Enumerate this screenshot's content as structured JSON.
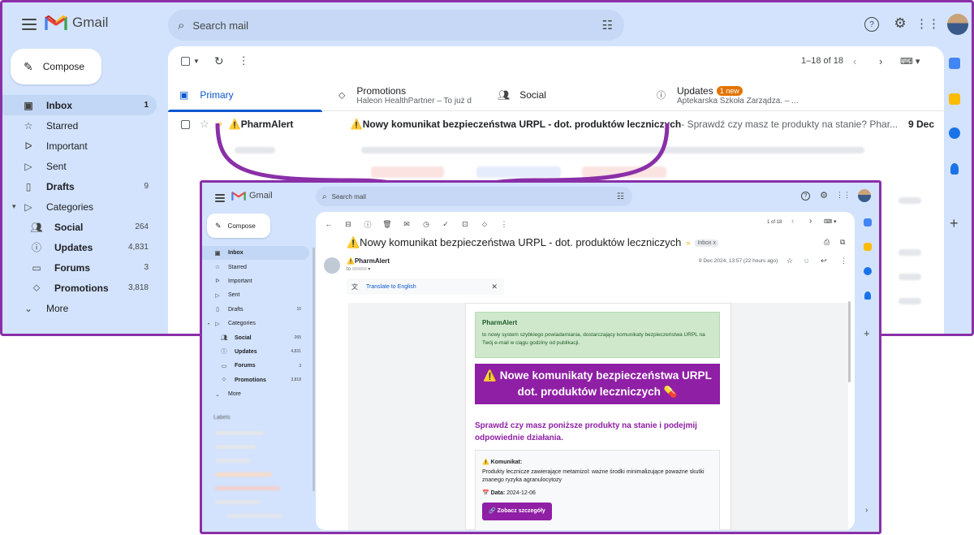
{
  "app": {
    "logo_text": "Gmail",
    "search_placeholder": "Search mail",
    "compose_label": "Compose"
  },
  "colors": {
    "accent_purple": "#8f1fa5",
    "frame_purple": "#8a2fa8",
    "gmail_bg": "#d3e3fd",
    "primary_blue": "#0b57d0",
    "updates_badge": "#e37400",
    "green_box": "#cfe8cc"
  },
  "back": {
    "nav": [
      {
        "label": "Inbox",
        "count": "1",
        "icon": "inbox-icon",
        "bold": true,
        "active": true
      },
      {
        "label": "Starred",
        "count": "",
        "icon": "star-icon"
      },
      {
        "label": "Important",
        "count": "",
        "icon": "important-icon"
      },
      {
        "label": "Sent",
        "count": "",
        "icon": "send-icon"
      },
      {
        "label": "Drafts",
        "count": "9",
        "icon": "draft-icon",
        "bold": true
      },
      {
        "label": "Categories",
        "count": "",
        "icon": "label-icon"
      },
      {
        "label": "Social",
        "count": "264",
        "icon": "people-icon",
        "bold": true
      },
      {
        "label": "Updates",
        "count": "4,831",
        "icon": "info-icon",
        "bold": true
      },
      {
        "label": "Forums",
        "count": "3",
        "icon": "forum-icon",
        "bold": true
      },
      {
        "label": "Promotions",
        "count": "3,818",
        "icon": "tag-icon",
        "bold": true
      },
      {
        "label": "More",
        "count": "",
        "icon": "chevron-down-icon"
      }
    ],
    "pagination": "1–18 of 18",
    "tabs": [
      {
        "label": "Primary",
        "sub": "",
        "badge": ""
      },
      {
        "label": "Promotions",
        "sub": "Haleon HealthPartner – To już d...",
        "badge": ""
      },
      {
        "label": "Social",
        "sub": "",
        "badge": ""
      },
      {
        "label": "Updates",
        "sub": "Aptekarska Szkoła Zarządza. – ...",
        "badge": "1 new"
      }
    ],
    "first_row": {
      "sender": "⚠️PharmAlert",
      "subject": "⚠️Nowy komunikat bezpieczeństwa URPL - dot. produktów leczniczych",
      "snippet": " - Sprawdź czy masz te produkty na stanie? Phar...",
      "date": "9 Dec"
    }
  },
  "front": {
    "nav": [
      {
        "label": "Inbox",
        "count": "",
        "icon": "inbox-icon",
        "bold": true,
        "active": true
      },
      {
        "label": "Starred",
        "count": "",
        "icon": "star-icon"
      },
      {
        "label": "Important",
        "count": "",
        "icon": "important-icon"
      },
      {
        "label": "Sent",
        "count": "",
        "icon": "send-icon"
      },
      {
        "label": "Drafts",
        "count": "10",
        "icon": "draft-icon"
      },
      {
        "label": "Categories",
        "count": "",
        "icon": "label-icon"
      },
      {
        "label": "Social",
        "count": "265",
        "icon": "people-icon",
        "bold": true
      },
      {
        "label": "Updates",
        "count": "4,831",
        "icon": "info-icon",
        "bold": true
      },
      {
        "label": "Forums",
        "count": "3",
        "icon": "forum-icon",
        "bold": true
      },
      {
        "label": "Promotions",
        "count": "3,818",
        "icon": "tag-icon",
        "bold": true
      },
      {
        "label": "More",
        "count": "",
        "icon": "chevron-down-icon"
      }
    ],
    "labels_heading": "Labels",
    "pagination": "1 of 18",
    "subject": "⚠️Nowy komunikat bezpieczeństwa URPL - dot. produktów leczniczych",
    "inbox_chip": "Inbox x",
    "sender": "⚠️PharmAlert",
    "to_line": "to",
    "date": "9 Dec 2024, 13:57 (22 hours ago)",
    "translate_label": "Translate to English",
    "green_title": "PharmAlert",
    "green_text": "to nowy system szybkiego powiadamiania, dostarczający komunikaty bezpieczeństwa URPL na Twój e-mail w ciągu godziny od publikacji.",
    "banner_line1": "⚠️ Nowe komunikaty bezpieczeństwa URPL",
    "banner_line2": "dot. produktów leczniczych 💊",
    "purple_text": "Sprawdź czy masz poniższe produkty na stanie i podejmij odpowiednie działania.",
    "info_title": "⚠️ Komunikat:",
    "info_text": "Produkty lecznicze zawierające metamizol: ważne środki minimalizujące poważne skutki znanego ryzyka agranulocytozy",
    "info_date_label": "📅 Data:",
    "info_date": "2024-12-06",
    "details_button": "🔗 Zobacz szczegóły"
  }
}
